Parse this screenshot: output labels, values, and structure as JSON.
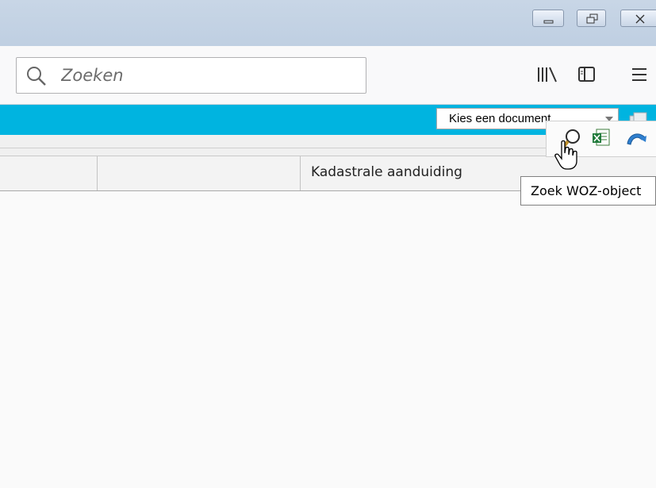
{
  "window": {
    "controls": [
      {
        "name": "minimize",
        "icon": "minimize-icon"
      },
      {
        "name": "restore",
        "icon": "restore-icon"
      },
      {
        "name": "close",
        "icon": "close-icon"
      }
    ]
  },
  "toolbar": {
    "search": {
      "placeholder": "Zoeken",
      "value": "",
      "icon": "search-icon"
    },
    "icons": [
      "library-icon",
      "sidebar-icon",
      "hamburger-menu-icon"
    ]
  },
  "app_bar": {
    "background_color": "#00b4e0",
    "document_select": {
      "selected": "Kies een document"
    }
  },
  "actions": {
    "icons": [
      "zoek-icon",
      "excel-export-icon",
      "back-icon"
    ],
    "tooltip": "Zoek WOZ-object"
  },
  "table": {
    "columns": [
      "",
      "",
      "Kadastrale aanduiding"
    ]
  }
}
